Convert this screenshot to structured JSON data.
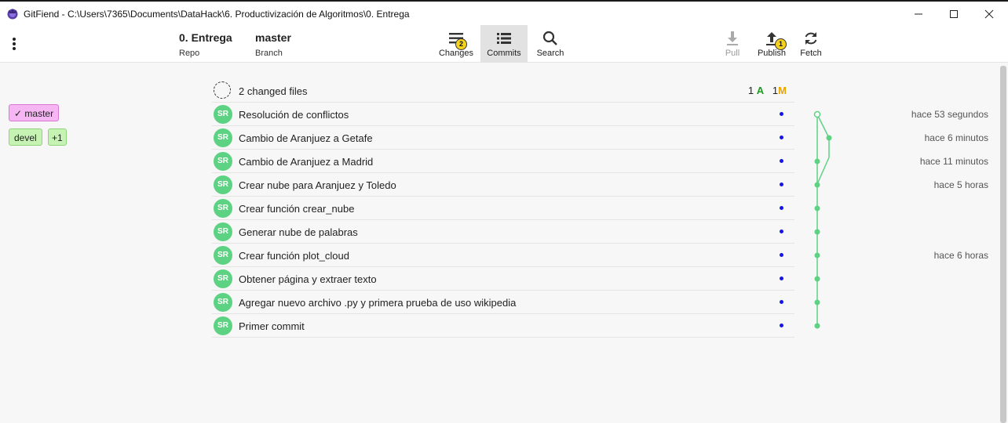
{
  "window": {
    "title": "GitFiend - C:\\Users\\7365\\Documents\\DataHack\\6. Productivización de Algoritmos\\0. Entrega"
  },
  "toolbar": {
    "repo_name": "0. Entrega",
    "repo_label": "Repo",
    "branch_name": "master",
    "branch_label": "Branch",
    "changes": {
      "label": "Changes",
      "badge": "2",
      "icon": "changes-icon"
    },
    "commits": {
      "label": "Commits",
      "icon": "list-icon"
    },
    "search": {
      "label": "Search",
      "icon": "search-icon"
    },
    "pull": {
      "label": "Pull",
      "icon": "download-icon"
    },
    "publish": {
      "label": "Publish",
      "badge": "1",
      "icon": "upload-icon"
    },
    "fetch": {
      "label": "Fetch",
      "icon": "refresh-icon"
    }
  },
  "branches": {
    "master": {
      "check": "✓",
      "label": "master"
    },
    "devel": {
      "label": "devel"
    },
    "extra": "+1"
  },
  "changed_files": {
    "label": "2 changed files",
    "added_count": "1",
    "added_letter": "A",
    "modified_count": "1",
    "modified_letter": "M"
  },
  "commits": [
    {
      "author": "SR",
      "message": "Resolución de conflictos",
      "time": "hace 53 segundos"
    },
    {
      "author": "SR",
      "message": "Cambio de Aranjuez a Getafe",
      "time": "hace 6 minutos"
    },
    {
      "author": "SR",
      "message": "Cambio de Aranjuez a Madrid",
      "time": "hace 11 minutos"
    },
    {
      "author": "SR",
      "message": "Crear nube para Aranjuez y Toledo",
      "time": "hace 5 horas"
    },
    {
      "author": "SR",
      "message": "Crear función crear_nube",
      "time": ""
    },
    {
      "author": "SR",
      "message": "Generar nube de palabras",
      "time": ""
    },
    {
      "author": "SR",
      "message": "Crear función plot_cloud",
      "time": "hace 6 horas"
    },
    {
      "author": "SR",
      "message": "Obtener página y extraer texto",
      "time": ""
    },
    {
      "author": "SR",
      "message": "Agregar nuevo archivo .py y primera prueba de uso wikipedia",
      "time": ""
    },
    {
      "author": "SR",
      "message": "Primer commit",
      "time": ""
    }
  ],
  "colors": {
    "graph": "#5ed283",
    "avatar": "#5ed283",
    "dot": "#1515e8",
    "badge": "#f5d21e"
  }
}
